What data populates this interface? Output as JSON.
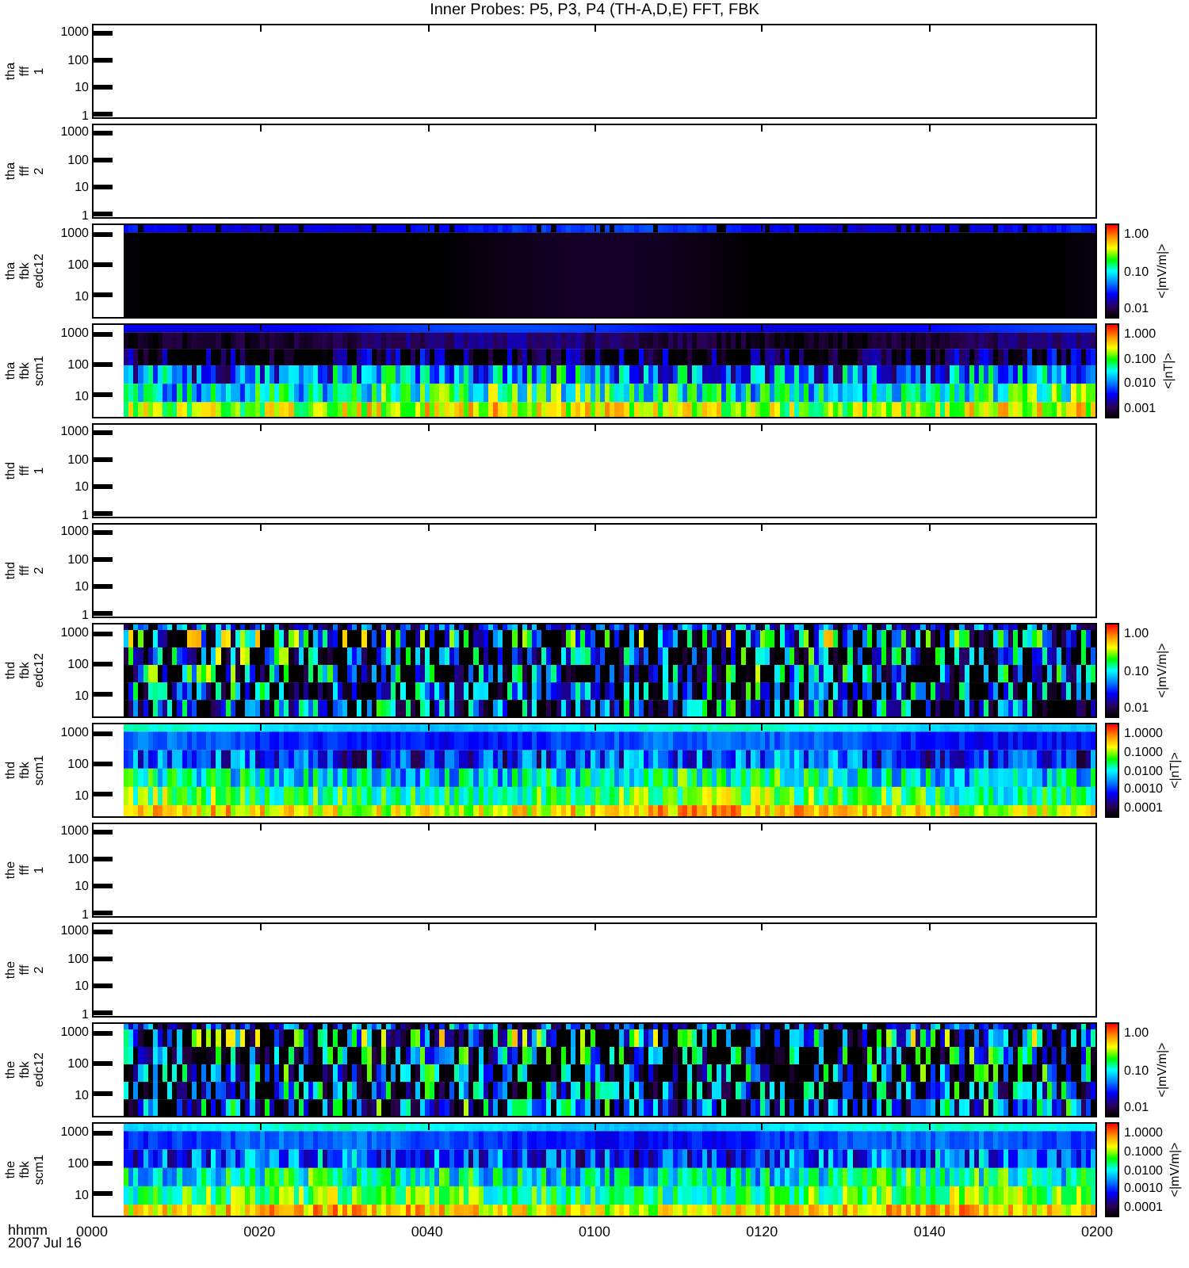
{
  "title": "Inner Probes: P5, P3, P4 (TH-A,D,E) FFT, FBK",
  "panels": [
    {
      "kind": "empty",
      "label": [
        "tha",
        "fff",
        "1"
      ],
      "yticks": [
        "1000",
        "100",
        "10",
        "1"
      ]
    },
    {
      "kind": "empty",
      "label": [
        "tha",
        "fff",
        "2"
      ],
      "yticks": [
        "1000",
        "100",
        "10",
        "1"
      ]
    },
    {
      "kind": "edc-dark",
      "label": [
        "tha",
        "fbk",
        "edc12"
      ],
      "yticks": [
        "1000",
        "100",
        "10"
      ],
      "colorbar": {
        "ticks": [
          "1.00",
          "0.10",
          "0.01"
        ],
        "unit": "<|mV/m|>"
      }
    },
    {
      "kind": "scm-quiet",
      "label": [
        "tha",
        "fbk",
        "scm1"
      ],
      "yticks": [
        "1000",
        "100",
        "10"
      ],
      "colorbar": {
        "ticks": [
          "1.000",
          "0.100",
          "0.010",
          "0.001"
        ],
        "unit": "<|nT|>"
      }
    },
    {
      "kind": "empty",
      "label": [
        "thd",
        "fff",
        "1"
      ],
      "yticks": [
        "1000",
        "100",
        "10",
        "1"
      ]
    },
    {
      "kind": "empty",
      "label": [
        "thd",
        "fff",
        "2"
      ],
      "yticks": [
        "1000",
        "100",
        "10",
        "1"
      ]
    },
    {
      "kind": "edc",
      "label": [
        "thd",
        "fbk",
        "edc12"
      ],
      "yticks": [
        "1000",
        "100",
        "10"
      ],
      "colorbar": {
        "ticks": [
          "1.00",
          "0.10",
          "0.01"
        ],
        "unit": "<|mV/m|>"
      }
    },
    {
      "kind": "scm",
      "label": [
        "thd",
        "fbk",
        "scm1"
      ],
      "yticks": [
        "1000",
        "100",
        "10"
      ],
      "colorbar": {
        "ticks": [
          "1.0000",
          "0.1000",
          "0.0100",
          "0.0010",
          "0.0001"
        ],
        "unit": "<|nT|>"
      }
    },
    {
      "kind": "empty",
      "label": [
        "the",
        "fff",
        "1"
      ],
      "yticks": [
        "1000",
        "100",
        "10",
        "1"
      ]
    },
    {
      "kind": "empty",
      "label": [
        "the",
        "fff",
        "2"
      ],
      "yticks": [
        "1000",
        "100",
        "10",
        "1"
      ]
    },
    {
      "kind": "edc",
      "label": [
        "the",
        "fbk",
        "edc12"
      ],
      "yticks": [
        "1000",
        "100",
        "10"
      ],
      "colorbar": {
        "ticks": [
          "1.00",
          "0.10",
          "0.01"
        ],
        "unit": "<|mV/m|>"
      }
    },
    {
      "kind": "scm",
      "label": [
        "the",
        "fbk",
        "scm1"
      ],
      "yticks": [
        "1000",
        "100",
        "10"
      ],
      "colorbar": {
        "ticks": [
          "1.0000",
          "0.1000",
          "0.0100",
          "0.0010",
          "0.0001"
        ],
        "unit": "<|mV/m|>"
      }
    }
  ],
  "xaxis": {
    "unit": "hhmm",
    "date": "2007 Jul 16",
    "ticks": [
      "0000",
      "0020",
      "0040",
      "0100",
      "0120",
      "0140",
      "0200"
    ]
  }
}
